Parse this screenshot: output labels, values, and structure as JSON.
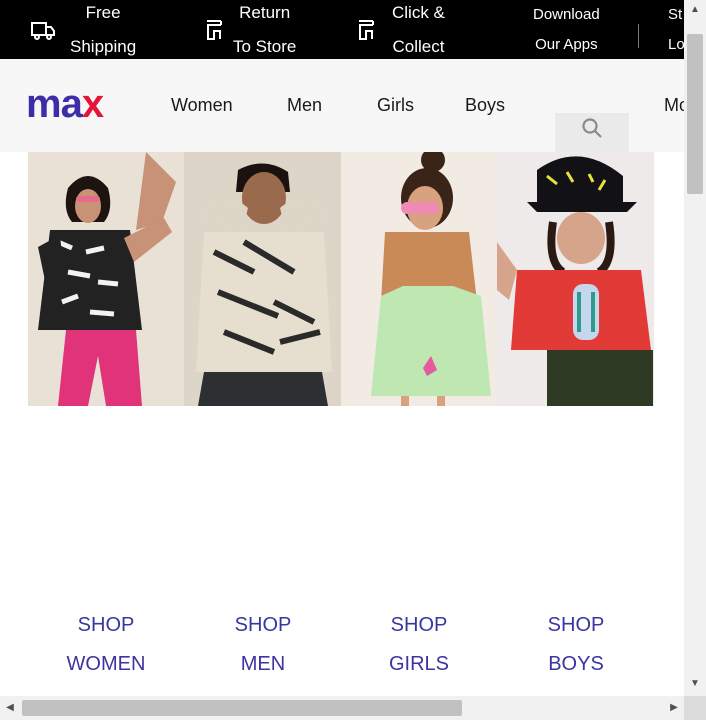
{
  "promo": {
    "free_shipping": [
      "Free",
      "Shipping"
    ],
    "return_to_store": [
      "Return",
      "To Store"
    ],
    "click_collect": [
      "Click &",
      "Collect"
    ],
    "download_apps": [
      "Download",
      "Our Apps"
    ],
    "store_locator": [
      "St",
      "Lo"
    ]
  },
  "header": {
    "logo": {
      "m": "m",
      "a": "a",
      "x": "x"
    },
    "nav": [
      "Women",
      "Men",
      "Girls",
      "Boys",
      "Mo"
    ]
  },
  "shop_links": [
    {
      "line1": "SHOP",
      "line2": "WOMEN"
    },
    {
      "line1": "SHOP",
      "line2": "MEN"
    },
    {
      "line1": "SHOP",
      "line2": "GIRLS"
    },
    {
      "line1": "SHOP",
      "line2": "BOYS"
    }
  ],
  "colors": {
    "brand_blue": "#3b2ea8",
    "brand_red": "#e3163a",
    "shop_link": "#3a35a0"
  },
  "icons": {
    "free_shipping": "truck-icon",
    "return_to_store": "store-icon",
    "click_collect": "store-icon",
    "search": "search-icon"
  }
}
